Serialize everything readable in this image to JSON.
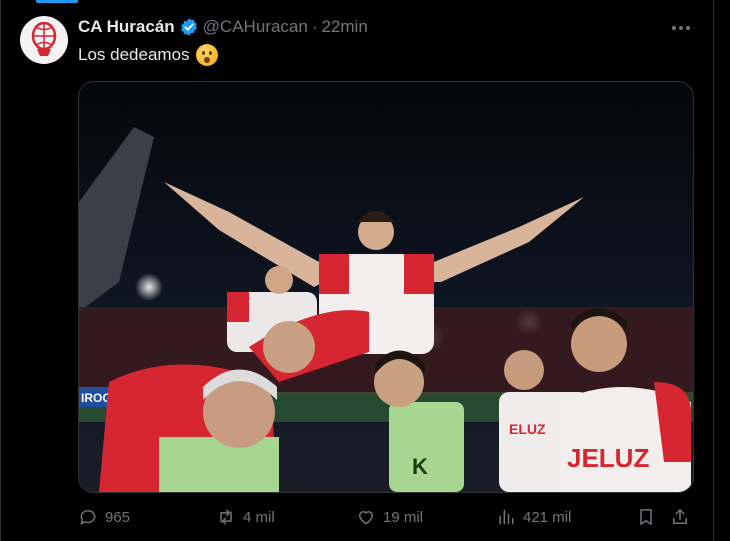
{
  "tweet": {
    "author_name": "CA Huracán",
    "handle": "@CAHuracan",
    "separator": "·",
    "time": "22min",
    "text": "Los dedeamos",
    "emoji": "flushed-face",
    "verified": true,
    "accent_color": "#1d9bf0"
  },
  "media": {
    "photo_texts": [
      "IROGAR",
      "ELUZ",
      "JELUZ"
    ]
  },
  "actions": {
    "replies": "965",
    "retweets": "4 mil",
    "likes": "19 mil",
    "views": "421 mil"
  }
}
